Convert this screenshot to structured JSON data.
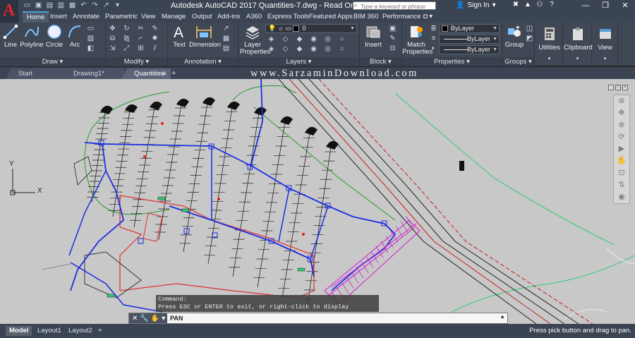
{
  "title_bar": {
    "title": "Autodesk AutoCAD 2017   Quantities-7.dwg - Read Only",
    "search_placeholder": "Type a keyword or phrase",
    "signin_label": "Sign In"
  },
  "ribbon_tabs": [
    "Home",
    "Insert",
    "Annotate",
    "Parametric",
    "View",
    "Manage",
    "Output",
    "Add-ins",
    "A360",
    "Express Tools",
    "Featured Apps",
    "BIM 360",
    "Performance"
  ],
  "ribbon": {
    "draw": {
      "tools": [
        "Line",
        "Polyline",
        "Circle",
        "Arc"
      ],
      "label": "Draw"
    },
    "modify": {
      "label": "Modify"
    },
    "annotation": {
      "text_label": "Text",
      "dimension_label": "Dimension",
      "label": "Annotation"
    },
    "layers": {
      "layer_properties_label": "Layer Properties",
      "layer_value": "0",
      "label": "Layers"
    },
    "block": {
      "insert_label": "Insert",
      "label": "Block"
    },
    "properties": {
      "match_label": "Match Properties",
      "color_value": "ByLayer",
      "linetype_value": "ByLayer",
      "lineweight_value": "ByLayer",
      "label": "Properties"
    },
    "groups": {
      "group_label": "Group",
      "label": "Groups"
    },
    "utilities_label": "Utilities",
    "clipboard_label": "Clipboard",
    "view_label": "View"
  },
  "doc_tabs": [
    "Start",
    "Drawing1*",
    "Quantities-7*"
  ],
  "watermark": "www.SarzaminDownload.com",
  "ucs": {
    "y_label": "Y",
    "x_label": "X"
  },
  "command": {
    "history_line1": "Command:",
    "history_line2": "Press ESC or ENTER to exit, or right-click to display shortcut menu.",
    "current": "PAN"
  },
  "layout_tabs": [
    "Model",
    "Layout1",
    "Layout2"
  ],
  "status_text": "Press pick button and drag to pan.",
  "colors": {
    "accent": "#4e9ed8",
    "canvas": "#c8c8c8",
    "brand_red": "#e3262d"
  }
}
